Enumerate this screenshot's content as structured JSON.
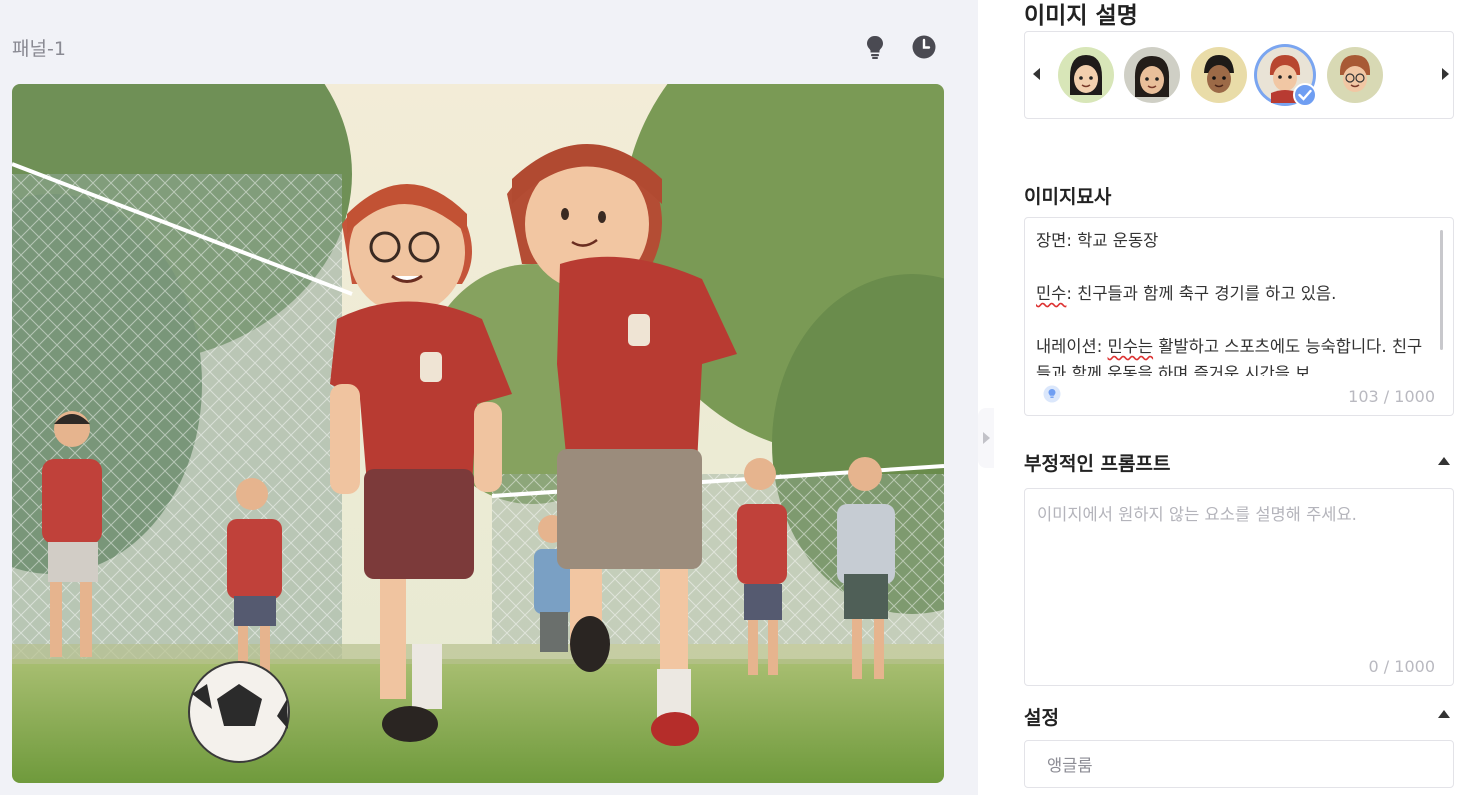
{
  "canvas_panel": {
    "title": "패널-1",
    "icons": [
      "lightbulb-icon",
      "clock-icon"
    ]
  },
  "right_panel": {
    "image_description_title": "이미지 설명",
    "characters": [
      {
        "name": "avatar-1",
        "selected": false
      },
      {
        "name": "avatar-2",
        "selected": false
      },
      {
        "name": "avatar-3",
        "selected": false
      },
      {
        "name": "avatar-4",
        "selected": true
      },
      {
        "name": "avatar-5",
        "selected": false
      }
    ],
    "description_section": {
      "title": "이미지묘사",
      "line1": "장면: 학교 운동장",
      "line2_name": "민수",
      "line2_rest": ": 친구들과 함께 축구 경기를 하고 있음.",
      "line3_prefix": "내레이션: ",
      "line3_name": "민수는",
      "line3_rest": " 활발하고 스포츠에도 능숙합니다. 친구들과 함께 운동을 하며 즐거운 시간을 보",
      "counter": "103 / 1000"
    },
    "negative_prompt": {
      "title": "부정적인 프롬프트",
      "placeholder": "이미지에서 원하지 않는 요소를 설명해 주세요.",
      "counter": "0 / 1000"
    },
    "settings": {
      "title": "설정",
      "style_value": "앵글룸"
    }
  },
  "colors": {
    "accent": "#6f9ef2",
    "panel_bg": "#f1f2f7",
    "jersey_red": "#c0413a"
  }
}
